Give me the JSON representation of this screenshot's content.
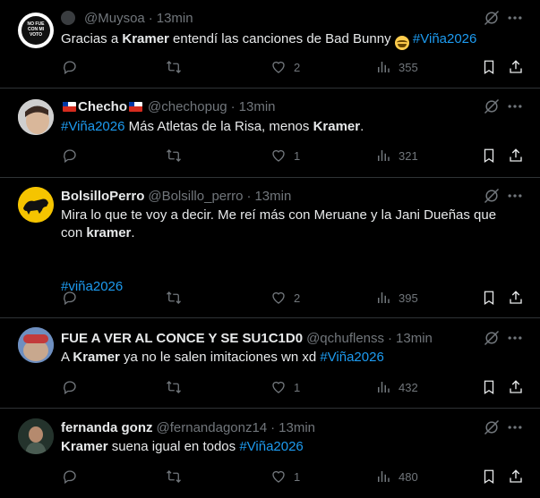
{
  "tweets": [
    {
      "display_name": "",
      "handle": "@Muysoa",
      "time": "13min",
      "avatar_label": "NO FUE CON MI VOTO",
      "segments": [
        {
          "t": "Gracias a ",
          "k": "n"
        },
        {
          "t": "Kramer",
          "k": "b"
        },
        {
          "t": " entendí las canciones de Bad Bunny ",
          "k": "n"
        },
        {
          "t": "😂",
          "k": "e"
        },
        {
          "t": " ",
          "k": "n"
        },
        {
          "t": "#Viña2026",
          "k": "h"
        }
      ],
      "replies": "",
      "retweets": "",
      "likes": "2",
      "views": "355"
    },
    {
      "display_name": "Checho",
      "handle": "@chechopug",
      "time": "13min",
      "segments": [
        {
          "t": "#Viña2026",
          "k": "h"
        },
        {
          "t": "  Más Atletas de la Risa, menos ",
          "k": "n"
        },
        {
          "t": "Kramer",
          "k": "b"
        },
        {
          "t": ".",
          "k": "n"
        }
      ],
      "replies": "",
      "retweets": "",
      "likes": "1",
      "views": "321"
    },
    {
      "display_name": "BolsilloPerro",
      "handle": "@Bolsillo_perro",
      "time": "13min",
      "segments": [
        {
          "t": "Mira lo que te voy a decir. Me reí más con Meruane y la Jani Dueñas que con ",
          "k": "n"
        },
        {
          "t": "kramer",
          "k": "b"
        },
        {
          "t": ".",
          "k": "n"
        },
        {
          "t": "",
          "k": "br"
        },
        {
          "t": "",
          "k": "br"
        },
        {
          "t": "",
          "k": "br"
        },
        {
          "t": "#viña2026",
          "k": "h"
        }
      ],
      "replies": "",
      "retweets": "",
      "likes": "2",
      "views": "395"
    },
    {
      "display_name": "FUE A VER AL CONCE Y SE SU1C1D0",
      "handle": "@qchuflenss",
      "time": "13min",
      "segments": [
        {
          "t": "A ",
          "k": "n"
        },
        {
          "t": "Kramer",
          "k": "b"
        },
        {
          "t": " ya no le salen imitaciones wn xd ",
          "k": "n"
        },
        {
          "t": "#Viña2026",
          "k": "h"
        }
      ],
      "replies": "",
      "retweets": "",
      "likes": "1",
      "views": "432"
    },
    {
      "display_name": "fernanda gonz",
      "handle": "@fernandagonz14",
      "time": "13min",
      "segments": [
        {
          "t": "Kramer",
          "k": "b"
        },
        {
          "t": " suena igual en todos ",
          "k": "n"
        },
        {
          "t": "#Viña2026",
          "k": "h"
        }
      ],
      "replies": "",
      "retweets": "",
      "likes": "1",
      "views": "480"
    }
  ],
  "icons": {
    "reply": "reply-icon",
    "retweet": "retweet-icon",
    "like": "like-icon",
    "views": "views-icon",
    "bookmark": "bookmark-icon",
    "share": "share-icon",
    "grok": "grok-icon",
    "more": "more-icon"
  },
  "colors": {
    "background": "#000000",
    "text": "#e7e9ea",
    "muted": "#71767b",
    "link": "#1d9bf0",
    "divider": "#2f3336"
  }
}
